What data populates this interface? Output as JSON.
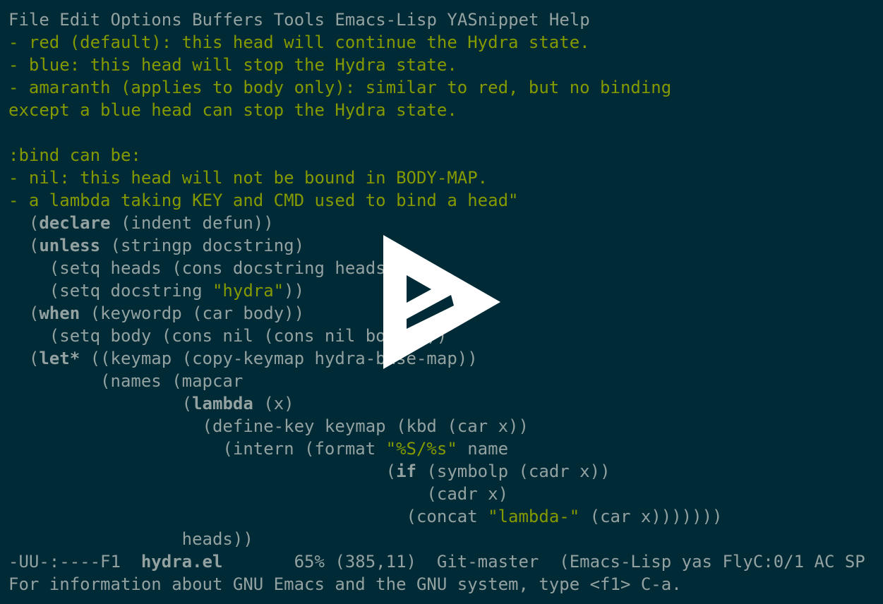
{
  "menu": {
    "items": [
      "File",
      "Edit",
      "Options",
      "Buffers",
      "Tools",
      "Emacs-Lisp",
      "YASnippet",
      "Help"
    ]
  },
  "doc_lines": [
    "- red (default): this head will continue the Hydra state.",
    "- blue: this head will stop the Hydra state.",
    "- amaranth (applies to body only): similar to red, but no binding",
    "except a blue head can stop the Hydra state.",
    "",
    ":bind can be:",
    "- nil: this head will not be bound in BODY-MAP.",
    "- a lambda taking KEY and CMD used to bind a head\""
  ],
  "code": {
    "l1_pre": "  (",
    "l1_kw": "declare",
    "l1_post": " (indent defun))",
    "l2_pre": "  (",
    "l2_kw": "unless",
    "l2_post": " (stringp docstring)",
    "l3": "    (setq heads (cons docstring heads))",
    "l4_pre": "    (setq docstring ",
    "l4_str": "\"hydra\"",
    "l4_post": "))",
    "l5_pre": "  (",
    "l5_kw": "when",
    "l5_post": " (keywordp (car body))",
    "l6": "    (setq body (cons nil (cons nil body))))",
    "l7_pre": "  (",
    "l7_kw": "let*",
    "l7_post": " ((keymap (copy-keymap hydra-base-map))",
    "l8": "         (names (mapcar",
    "l9_pre": "                 (",
    "l9_kw": "lambda",
    "l9_post": " (x)",
    "l10": "                   (define-key keymap (kbd (car x))",
    "l11_pre": "                     (intern (format ",
    "l11_str": "\"%S/%s\"",
    "l11_post": " name",
    "l12_pre": "                                     (",
    "l12_kw": "if",
    "l12_post": " (symbolp (cadr x))",
    "l13": "                                         (cadr x)",
    "l14_pre": "                                       (concat ",
    "l14_str": "\"lambda-\"",
    "l14_post": " (car x)))))))",
    "l15": "                 heads))"
  },
  "mode_line": {
    "prefix": "-UU-:----F1  ",
    "buffer": "hydra.el",
    "rest": "       65% (385,11)  Git-master  (Emacs-Lisp yas FlyC:0/1 AC SP"
  },
  "echo_area": "For information about GNU Emacs and the GNU system, type <f1> C-a.",
  "overlay": {
    "icon": "play-icon"
  },
  "colors": {
    "background": "#002b36",
    "foreground": "#93a1a1",
    "doc": "#859900"
  }
}
